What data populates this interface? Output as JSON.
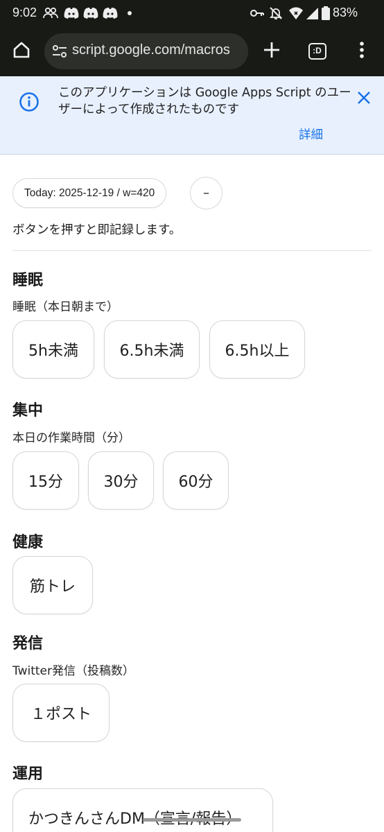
{
  "status_bar": {
    "time": "9:02",
    "battery": "83%",
    "left_icons": [
      "people-icon",
      "discord-icon",
      "discord-icon",
      "discord-icon",
      "dot-icon"
    ],
    "right_icons": [
      "key-icon",
      "mute-icon",
      "wifi-icon",
      "signal-icon",
      "battery-icon"
    ]
  },
  "browser": {
    "url": "script.google.com/macros",
    "tab_icon_label": ":D"
  },
  "banner": {
    "message": "このアプリケーションは Google Apps Script のユーザーによって作成されたものです",
    "details_link": "詳細"
  },
  "header": {
    "today_pill": "Today: 2025-12-19 / w=420",
    "dash_button": "–",
    "hint": "ボタンを押すと即記録します。"
  },
  "sections": [
    {
      "title": "睡眠",
      "subtitle": "睡眠（本日朝まで）",
      "buttons": [
        "5h未満",
        "6.5h未満",
        "6.5h以上"
      ]
    },
    {
      "title": "集中",
      "subtitle": "本日の作業時間（分）",
      "buttons": [
        "15分",
        "30分",
        "60分"
      ]
    },
    {
      "title": "健康",
      "subtitle": "",
      "buttons": [
        "筋トレ"
      ]
    },
    {
      "title": "発信",
      "subtitle": "Twitter発信（投稿数）",
      "buttons": [
        "１ポスト"
      ]
    },
    {
      "title": "運用",
      "subtitle": "",
      "buttons": [
        "かつきんさんDM（宣言/報告）"
      ]
    }
  ],
  "colors": {
    "chrome_bg": "#181a16",
    "banner_bg": "#e8f0fe",
    "accent": "#1a73e8"
  }
}
